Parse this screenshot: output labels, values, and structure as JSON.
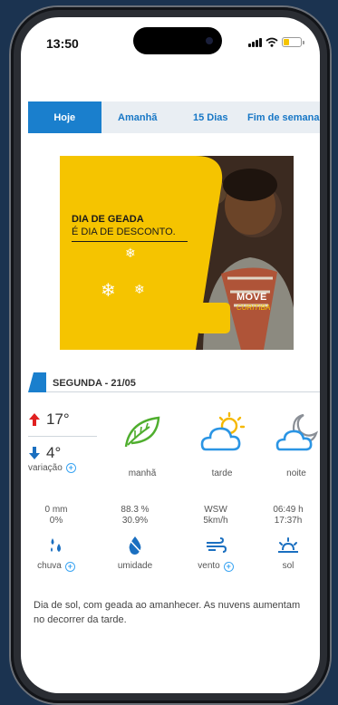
{
  "status_bar": {
    "time": "13:50"
  },
  "tabs": [
    {
      "label": "Hoje",
      "active": true
    },
    {
      "label": "Amanhã",
      "active": false
    },
    {
      "label": "15 Dias",
      "active": false
    },
    {
      "label": "Fim de semana",
      "active": false
    }
  ],
  "ad": {
    "headline": "DIA DE GEADA",
    "subline": "É DIA DE DESCONTO.",
    "brand": "MOVE",
    "brand_sub": "CURITIBA"
  },
  "day": {
    "label": "SEGUNDA - 21/05"
  },
  "temps": {
    "max": "17°",
    "min": "4°",
    "variacao_label": "variação"
  },
  "periods": [
    {
      "label": "manhã",
      "icon": "leaf-icon"
    },
    {
      "label": "tarde",
      "icon": "sun-cloud-icon"
    },
    {
      "label": "noite",
      "icon": "moon-cloud-icon"
    }
  ],
  "stats": {
    "chuva": {
      "line1": "0 mm",
      "line2": "0%",
      "label": "chuva"
    },
    "umidade": {
      "line1": "88.3 %",
      "line2": "30.9%",
      "label": "umidade"
    },
    "vento": {
      "line1": "WSW",
      "line2": "5km/h",
      "label": "vento"
    },
    "sol": {
      "line1": "06:49 h",
      "line2": "17:37h",
      "label": "sol"
    }
  },
  "description": "Dia de sol, com geada ao amanhecer. As nuvens aumentam no decorrer da tarde.",
  "colors": {
    "accent": "#1a7fcd",
    "icon_blue": "#3aa4f2",
    "up_arrow": "#e02020",
    "down_arrow": "#1a6fc0",
    "ad_yellow": "#f5c400"
  }
}
